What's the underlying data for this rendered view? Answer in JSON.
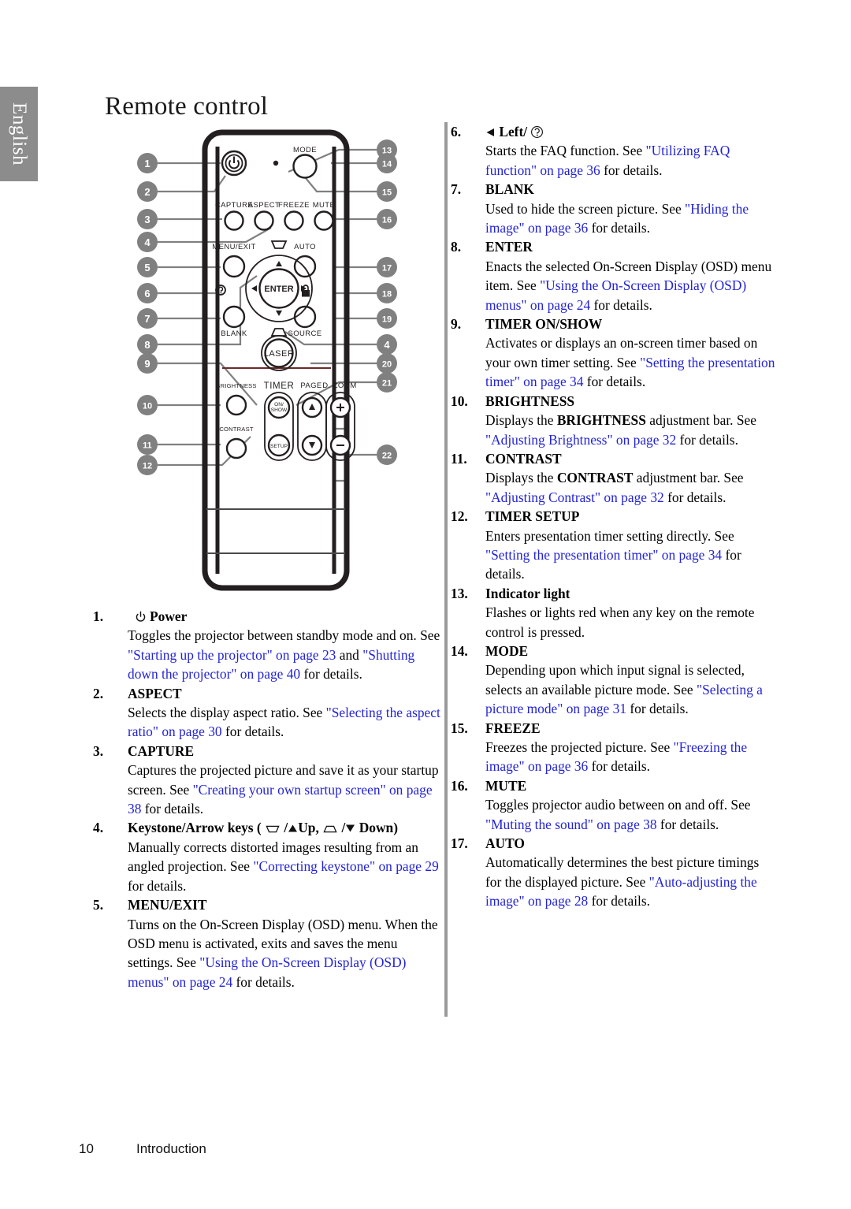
{
  "language_tab": {
    "label": "English"
  },
  "header": {
    "title": "Remote control"
  },
  "footer": {
    "page_number": "10",
    "section": "Introduction"
  },
  "figure": {
    "name": "remote-control-diagram",
    "button_labels": {
      "mode": "MODE",
      "capture": "CAPTURE",
      "aspect": "ASPECT",
      "freeze": "FREEZE",
      "mute": "MUTE",
      "menu_exit": "MENU/EXIT",
      "auto": "AUTO",
      "enter": "ENTER",
      "blank": "BLANK",
      "source": "SOURCE",
      "laser": "LASER",
      "brightness": "BRIGHTNESS",
      "contrast": "CONTRAST",
      "timer": "TIMER",
      "timer_on_show": "ON/ SHOW",
      "timer_setup": "SETUP",
      "page": "PAGE",
      "d_zoom": "D. ZOOM",
      "plus": "+",
      "minus": "−"
    },
    "callouts_left": [
      "1",
      "2",
      "3",
      "4",
      "5",
      "6",
      "7",
      "8",
      "9",
      "10",
      "11",
      "12"
    ],
    "callouts_right": [
      "13",
      "14",
      "15",
      "16",
      "17",
      "18",
      "19",
      "4",
      "20",
      "21",
      "22"
    ]
  },
  "items_left": [
    {
      "num": "1.",
      "label": "Power",
      "label_icon": "power-icon",
      "body": [
        {
          "t": "Toggles the projector between standby mode and on. See ",
          "k": "plain"
        },
        {
          "t": "\"Starting up the projector\" on page 23",
          "k": "link"
        },
        {
          "t": " and ",
          "k": "plain"
        },
        {
          "t": "\"Shutting down the projector\" on page 40",
          "k": "link"
        },
        {
          "t": " for details.",
          "k": "plain"
        }
      ]
    },
    {
      "num": "2.",
      "label": "ASPECT",
      "body": [
        {
          "t": "Selects the display aspect ratio. See ",
          "k": "plain"
        },
        {
          "t": "\"Selecting the aspect ratio\" on page 30",
          "k": "link"
        },
        {
          "t": " for details.",
          "k": "plain"
        }
      ]
    },
    {
      "num": "3.",
      "label": "CAPTURE",
      "body": [
        {
          "t": "Captures the projected picture and save it as your startup screen. See ",
          "k": "plain"
        },
        {
          "t": "\"Creating your own startup screen\" on page 38",
          "k": "link"
        },
        {
          "t": " for details.",
          "k": "plain"
        }
      ]
    },
    {
      "num": "4.",
      "label": "Keystone/Arrow keys (  /▲Up,  /▼ Down)",
      "label_kind": "keystone",
      "body": [
        {
          "t": "Manually corrects distorted images resulting from an angled projection. See ",
          "k": "plain"
        },
        {
          "t": "\"Correcting keystone\" on page 29",
          "k": "link"
        },
        {
          "t": " for details.",
          "k": "plain"
        }
      ]
    },
    {
      "num": "5.",
      "label": "MENU/EXIT",
      "body": [
        {
          "t": "Turns on the On-Screen Display (OSD) menu. When the OSD menu is activated, exits and saves the menu settings. See ",
          "k": "plain"
        },
        {
          "t": "\"Using the On-Screen Display (OSD) menus\" on page 24",
          "k": "link"
        },
        {
          "t": " for details.",
          "k": "plain"
        }
      ]
    }
  ],
  "items_right": [
    {
      "num": "6.",
      "label": "Left/",
      "label_kind": "left-faq",
      "body": [
        {
          "t": "Starts the FAQ function. See ",
          "k": "plain"
        },
        {
          "t": "\"Utilizing FAQ function\" on page 36",
          "k": "link"
        },
        {
          "t": " for details.",
          "k": "plain"
        }
      ]
    },
    {
      "num": "7.",
      "label": "BLANK",
      "body": [
        {
          "t": "Used to hide the screen picture. See ",
          "k": "plain"
        },
        {
          "t": "\"Hiding the image\" on page 36",
          "k": "link"
        },
        {
          "t": " for details.",
          "k": "plain"
        }
      ]
    },
    {
      "num": "8.",
      "label": "ENTER",
      "body": [
        {
          "t": "Enacts the selected On-Screen Display (OSD) menu item. See ",
          "k": "plain"
        },
        {
          "t": "\"Using the On-Screen Display (OSD) menus\" on page 24",
          "k": "link"
        },
        {
          "t": " for details.",
          "k": "plain"
        }
      ]
    },
    {
      "num": "9.",
      "label": "TIMER ON/SHOW",
      "body": [
        {
          "t": "Activates or displays an on-screen timer based on your own timer setting. See ",
          "k": "plain"
        },
        {
          "t": "\"Setting the presentation timer\" on page 34",
          "k": "link"
        },
        {
          "t": " for details.",
          "k": "plain"
        }
      ]
    },
    {
      "num": "10.",
      "label": "BRIGHTNESS",
      "body": [
        {
          "t": "Displays the ",
          "k": "plain"
        },
        {
          "t": "BRIGHTNESS",
          "k": "bold"
        },
        {
          "t": " adjustment bar. See ",
          "k": "plain"
        },
        {
          "t": "\"Adjusting Brightness\" on page 32",
          "k": "link"
        },
        {
          "t": " for details.",
          "k": "plain"
        }
      ]
    },
    {
      "num": "11.",
      "label": "CONTRAST",
      "body": [
        {
          "t": "Displays the ",
          "k": "plain"
        },
        {
          "t": "CONTRAST",
          "k": "bold"
        },
        {
          "t": " adjustment bar. See ",
          "k": "plain"
        },
        {
          "t": "\"Adjusting Contrast\" on page 32",
          "k": "link"
        },
        {
          "t": " for details.",
          "k": "plain"
        }
      ]
    },
    {
      "num": "12.",
      "label": "TIMER SETUP",
      "body": [
        {
          "t": "Enters presentation timer setting directly. See ",
          "k": "plain"
        },
        {
          "t": "\"Setting the presentation timer\" on page 34",
          "k": "link"
        },
        {
          "t": " for details.",
          "k": "plain"
        }
      ]
    },
    {
      "num": "13.",
      "label": "Indicator light",
      "body": [
        {
          "t": "Flashes or lights red when any key on the remote control is pressed.",
          "k": "plain"
        }
      ]
    },
    {
      "num": "14.",
      "label": "MODE",
      "body": [
        {
          "t": "Depending upon which input signal is selected, selects an available picture mode. See ",
          "k": "plain"
        },
        {
          "t": "\"Selecting a picture mode\" on page 31",
          "k": "link"
        },
        {
          "t": " for details.",
          "k": "plain"
        }
      ]
    },
    {
      "num": "15.",
      "label": "FREEZE",
      "body": [
        {
          "t": "Freezes the projected picture. See ",
          "k": "plain"
        },
        {
          "t": "\"Freezing the image\" on page 36",
          "k": "link"
        },
        {
          "t": " for details.",
          "k": "plain"
        }
      ]
    },
    {
      "num": "16.",
      "label": "MUTE",
      "body": [
        {
          "t": "Toggles projector audio between on and off. See ",
          "k": "plain"
        },
        {
          "t": "\"Muting the sound\" on page 38",
          "k": "link"
        },
        {
          "t": " for details.",
          "k": "plain"
        }
      ]
    },
    {
      "num": "17.",
      "label": "AUTO",
      "body": [
        {
          "t": "Automatically determines the best picture timings for the displayed picture. See ",
          "k": "plain"
        },
        {
          "t": "\"Auto-adjusting the image\" on page 28",
          "k": "link"
        },
        {
          "t": " for details.",
          "k": "plain"
        }
      ]
    }
  ],
  "colors": {
    "link": "#2323d6",
    "tab_bg": "#8c8c8c",
    "callout_bg": "#808080",
    "divider": "#9a9a9a"
  }
}
